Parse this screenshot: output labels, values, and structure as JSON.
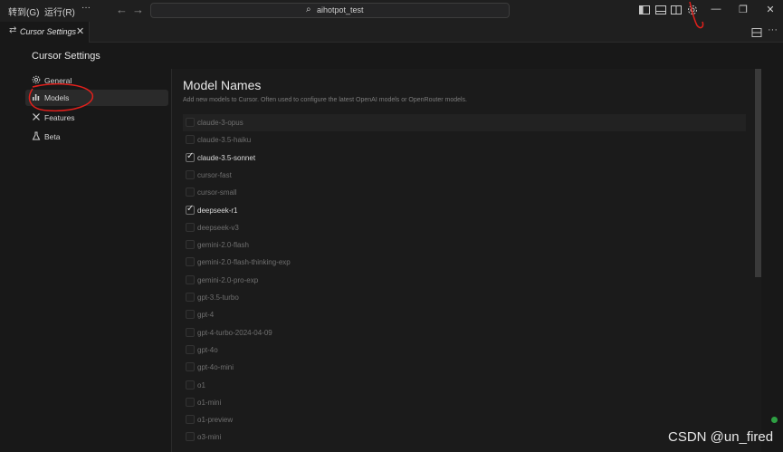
{
  "titlebar": {
    "menus": [
      "转到(G)",
      "运行(R)",
      "···"
    ],
    "search_text": "aihotpot_test",
    "back_icon": "arrow-left-icon",
    "forward_icon": "arrow-right-icon",
    "window_buttons": [
      "—",
      "❐",
      "✕"
    ]
  },
  "tab": {
    "label": "Cursor Settings"
  },
  "settings": {
    "title": "Cursor Settings",
    "sidebar": [
      {
        "label": "General",
        "icon": "gear-icon"
      },
      {
        "label": "Models",
        "icon": "chart-icon",
        "active": true
      },
      {
        "label": "Features",
        "icon": "wrench-icon"
      },
      {
        "label": "Beta",
        "icon": "flask-icon"
      }
    ]
  },
  "main": {
    "title": "Model Names",
    "description": "Add new models to Cursor. Often used to configure the latest OpenAI models or OpenRouter models.",
    "models": [
      {
        "name": "claude-3-opus",
        "checked": false
      },
      {
        "name": "claude-3.5-haiku",
        "checked": false
      },
      {
        "name": "claude-3.5-sonnet",
        "checked": true
      },
      {
        "name": "cursor-fast",
        "checked": false
      },
      {
        "name": "cursor-small",
        "checked": false
      },
      {
        "name": "deepseek-r1",
        "checked": true
      },
      {
        "name": "deepseek-v3",
        "checked": false
      },
      {
        "name": "gemini-2.0-flash",
        "checked": false
      },
      {
        "name": "gemini-2.0-flash-thinking-exp",
        "checked": false
      },
      {
        "name": "gemini-2.0-pro-exp",
        "checked": false
      },
      {
        "name": "gpt-3.5-turbo",
        "checked": false
      },
      {
        "name": "gpt-4",
        "checked": false
      },
      {
        "name": "gpt-4-turbo-2024-04-09",
        "checked": false
      },
      {
        "name": "gpt-4o",
        "checked": false
      },
      {
        "name": "gpt-4o-mini",
        "checked": false
      },
      {
        "name": "o1",
        "checked": false
      },
      {
        "name": "o1-mini",
        "checked": false
      },
      {
        "name": "o1-preview",
        "checked": false
      },
      {
        "name": "o3-mini",
        "checked": false
      }
    ]
  },
  "watermark": "CSDN @un_fired",
  "colors": {
    "background": "#181818",
    "annotation": "#e0201c",
    "status_green": "#2ea043"
  }
}
